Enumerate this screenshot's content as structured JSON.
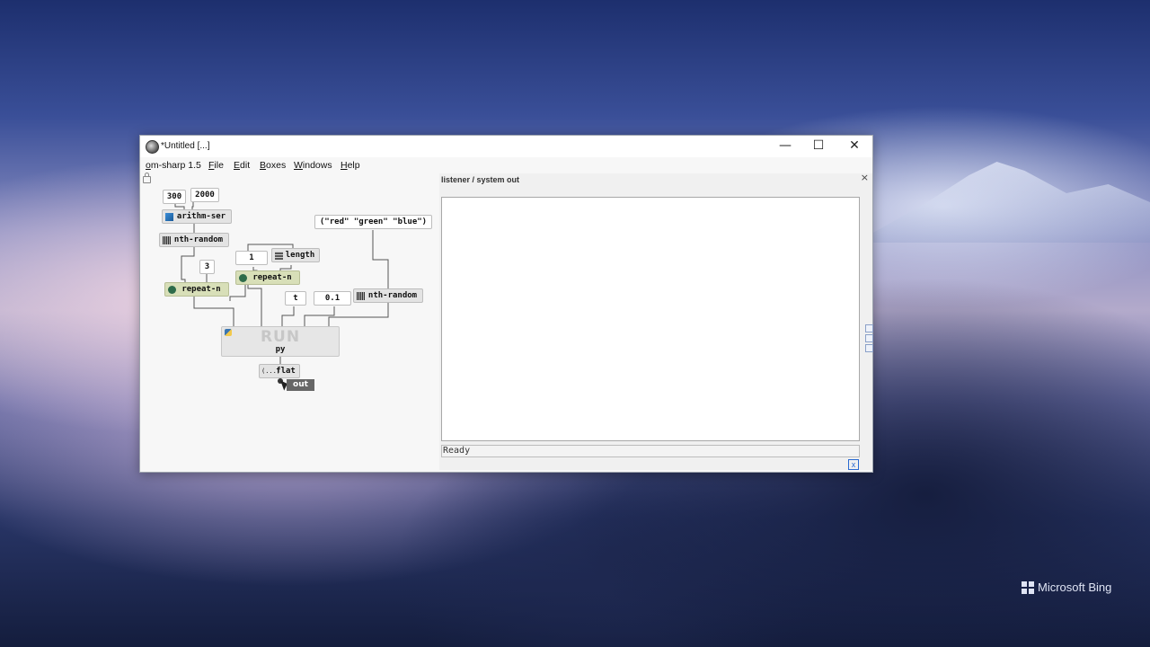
{
  "window": {
    "title": "*Untitled  [...]",
    "controls": {
      "minimize": "—",
      "maximize": "☐",
      "close": "✕"
    }
  },
  "menu": {
    "app": "om-sharp 1.5",
    "file": "File",
    "edit": "Edit",
    "boxes": "Boxes",
    "windows": "Windows",
    "help": "Help"
  },
  "patch": {
    "boxes": {
      "n300": "300",
      "n2000": "2000",
      "arithm_ser": "arithm-ser",
      "nth_random_1": "nth-random",
      "n3": "3",
      "repeat_n_1": "repeat-n",
      "n1": "1",
      "length": "length",
      "repeat_n_2": "repeat-n",
      "colors_list": "(\"red\" \"green\" \"blue\")",
      "t": "t",
      "n01": "0.1",
      "nth_random_2": "nth-random",
      "run": "RUN",
      "py": "py",
      "flat": "flat",
      "flat_icon": "(...)",
      "out": "out"
    }
  },
  "listener": {
    "title": "listener / system out",
    "close": "×",
    "status": "Ready",
    "clear": "x"
  },
  "desktop": {
    "watermark": "Microsoft Bing"
  }
}
